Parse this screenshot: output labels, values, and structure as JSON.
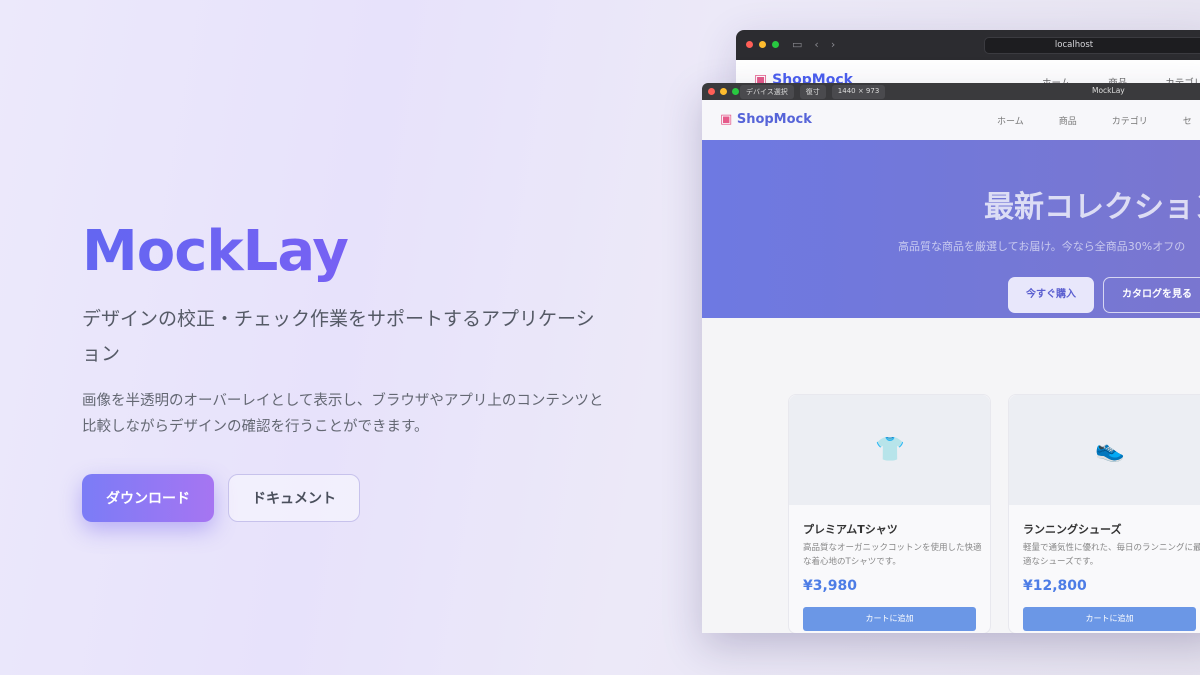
{
  "hero": {
    "title": "MockLay",
    "subtitle": "デザインの校正・チェック作業をサポートするアプリケーション",
    "description": "画像を半透明のオーバーレイとして表示し、ブラウザやアプリ上のコンテンツと比較しながらデザインの確認を行うことができます。",
    "download_label": "ダウンロード",
    "docs_label": "ドキュメント"
  },
  "browser": {
    "url": "localhost",
    "site": {
      "logo": "ShopMock",
      "nav": [
        "ホーム",
        "商品",
        "カテゴリ",
        "セ"
      ],
      "hero_title": "最新コレクション",
      "hero_sub": "高品質な商品を厳選してお届け。今なら全商品30%オフの",
      "buy_button": "今すぐ購入",
      "catalog_button": "カタログを見る"
    },
    "products": [
      {
        "name": "プレミアムTシャツ",
        "description": "高品質なオーガニックコットンを使用した快適な着心地のTシャツです。",
        "price": "¥3,980",
        "cart_label": "カートに追加",
        "icon": "tshirt-icon"
      },
      {
        "name": "ランニングシューズ",
        "description": "軽量で通気性に優れた、毎日のランニングに最適なシューズです。",
        "price": "¥12,800",
        "cart_label": "カートに追加",
        "icon": "shoe-icon"
      }
    ]
  },
  "overlay": {
    "tag1": "デバイス選択",
    "tag2": "復寸",
    "tag3": "1440 × 973",
    "title": "MockLay"
  },
  "colors": {
    "accent": "#6366f1",
    "accent2": "#a675f2",
    "price": "#4d7de6"
  }
}
